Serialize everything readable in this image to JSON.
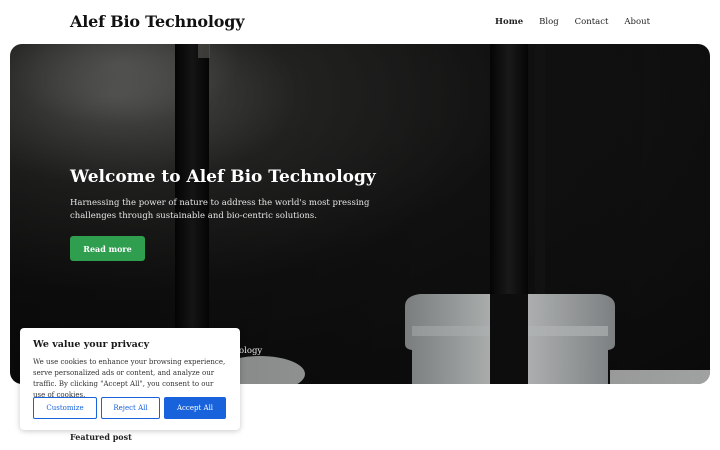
{
  "site": {
    "title": "Alef Bio Technology"
  },
  "nav": {
    "items": [
      "Home",
      "Blog",
      "Contact",
      "About"
    ],
    "active": "Home"
  },
  "hero": {
    "title": "Welcome to Alef Bio Technology",
    "text": "Harnessing the power of nature to address the world's most pressing challenges through sustainable and bio-centric solutions.",
    "button_label": "Read more",
    "caption_partial": "ology",
    "button_color": "#2f9e4f"
  },
  "featured": {
    "label": "Featured post"
  },
  "cookie": {
    "title": "We value your privacy",
    "text": "We use cookies to enhance your browsing experience, serve personalized ads or content, and analyze our traffic. By clicking \"Accept All\", you consent to our use of cookies.",
    "customize_label": "Customize",
    "reject_label": "Reject All",
    "accept_label": "Accept All",
    "accent_color": "#1863dc"
  }
}
